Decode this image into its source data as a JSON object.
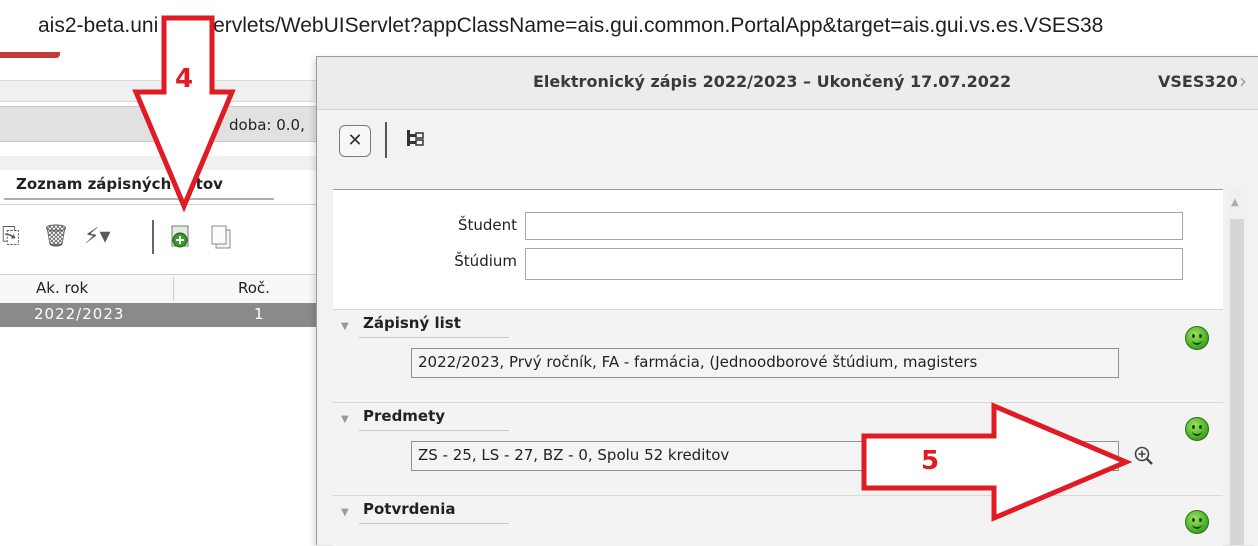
{
  "browser": {
    "url": "ais2-beta.uni          /ais/servlets/WebUIServlet?appClassName=ais.gui.common.PortalApp&target=ais.gui.vs.es.VSES38"
  },
  "left_panel": {
    "partial_label": "doba: 0.0,",
    "tab_label": "Zoznam zápisných listov",
    "table": {
      "headers": [
        "Ak. rok",
        "Roč."
      ],
      "rows": [
        {
          "ak_rok": "2022/2023",
          "roc": "1"
        }
      ]
    }
  },
  "dialog": {
    "title": "Elektronický zápis 2022/2023 – Ukončený 17.07.2022",
    "code": "VSES320",
    "fields": {
      "student_label": "Študent",
      "student_value": "",
      "studium_label": "Štúdium",
      "studium_value": ""
    },
    "sections": [
      {
        "title": "Zápisný list",
        "value": "2022/2023, Prvý ročník, FA - farmácia, (Jednoodborové štúdium, magisters",
        "status": "ok"
      },
      {
        "title": "Predmety",
        "value": "ZS - 25, LS - 27, BZ - 0, Spolu 52 kreditov",
        "status": "ok"
      },
      {
        "title": "Potvrdenia",
        "value": "",
        "status": "ok"
      }
    ]
  },
  "annotations": {
    "step_4": "4",
    "step_5": "5",
    "arrow_color": "#e01b24"
  }
}
